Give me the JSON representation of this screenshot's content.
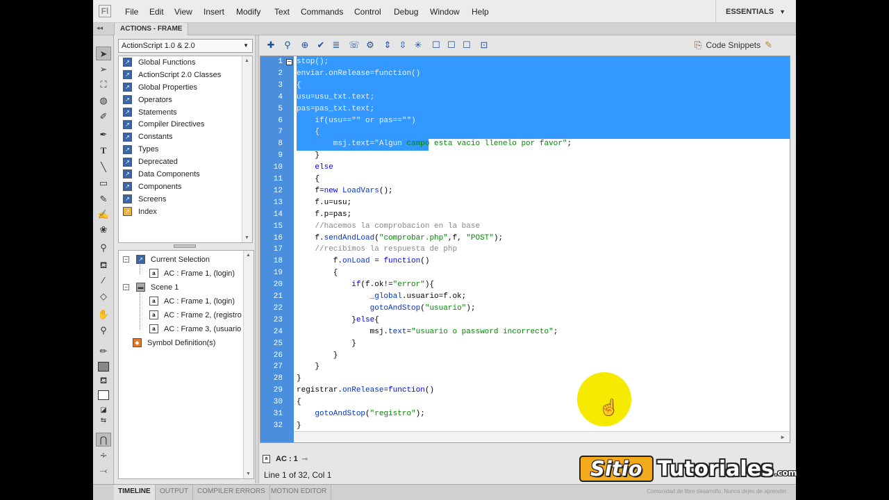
{
  "menubar": {
    "logo": "Fl",
    "items": [
      "File",
      "Edit",
      "View",
      "Insert",
      "Modify",
      "Text",
      "Commands",
      "Control",
      "Debug",
      "Window",
      "Help"
    ],
    "workspace": "ESSENTIALS"
  },
  "panel": {
    "title": "ACTIONS - FRAME",
    "collapse_glyph": "◂◂"
  },
  "toolbox": {
    "language": "ActionScript 1.0 & 2.0",
    "books": [
      "Global Functions",
      "ActionScript 2.0 Classes",
      "Global Properties",
      "Operators",
      "Statements",
      "Compiler Directives",
      "Constants",
      "Types",
      "Deprecated",
      "Data Components",
      "Components",
      "Screens",
      "Index"
    ]
  },
  "navigator": {
    "current_selection": "Current Selection",
    "current_frame": "AC : Frame 1, (login)",
    "scene": "Scene 1",
    "frames": [
      "AC : Frame 1, (login)",
      "AC : Frame 2, (registro",
      "AC : Frame 3, (usuario"
    ],
    "symbols": "Symbol Definition(s)"
  },
  "editor": {
    "code_snippets_label": "Code Snippets",
    "line_numbers": [
      "1",
      "2",
      "3",
      "4",
      "5",
      "6",
      "7",
      "8",
      "9",
      "10",
      "11",
      "12",
      "13",
      "14",
      "15",
      "16",
      "17",
      "18",
      "19",
      "20",
      "21",
      "22",
      "23",
      "24",
      "25",
      "26",
      "27",
      "28",
      "29",
      "30",
      "31",
      "32"
    ],
    "code": [
      "stop();",
      "enviar.onRelease=function()",
      "{",
      "usu=usu_txt.text;",
      "pas=pas_txt.text;",
      "    if(usu==\"\" or pas==\"\")",
      "    {",
      "        msj.text=\"Algun campo esta vacio llenelo por favor\";",
      "    }",
      "    else",
      "    {",
      "    f=new LoadVars();",
      "    f.u=usu;",
      "    f.p=pas;",
      "    //hacemos la comprobacion en la base",
      "    f.sendAndLoad(\"comprobar.php\",f, \"POST\");",
      "    //recibimos la respuesta de php",
      "        f.onLoad = function()",
      "        {",
      "            if(f.ok!=\"error\"){",
      "                _global.usuario=f.ok;",
      "                gotoAndStop(\"usuario\");",
      "            }else{",
      "                msj.text=\"usuario o password incorrecto\";",
      "            }",
      "        }",
      "    }",
      "}",
      "registrar.onRelease=function()",
      "{",
      "    gotoAndStop(\"registro\");",
      "}"
    ],
    "script_tab": "AC : 1",
    "status": "Line 1 of 32, Col 1"
  },
  "bottom_tabs": [
    "TIMELINE",
    "OUTPUT",
    "COMPILER ERRORS",
    "MOTION EDITOR"
  ],
  "footer_note": "Comunidad de libre desarrollo. Nunca dejes de aprender.",
  "watermark": {
    "part1": "Sitio",
    "part2": "Tutoriales",
    "suffix": ".com"
  },
  "colors": {
    "selection": "#3399ff",
    "gutter": "#4a8ede",
    "keyword": "#0000ff",
    "string": "#008800",
    "comment": "#888888",
    "cursor_highlight": "#f6ea00"
  }
}
